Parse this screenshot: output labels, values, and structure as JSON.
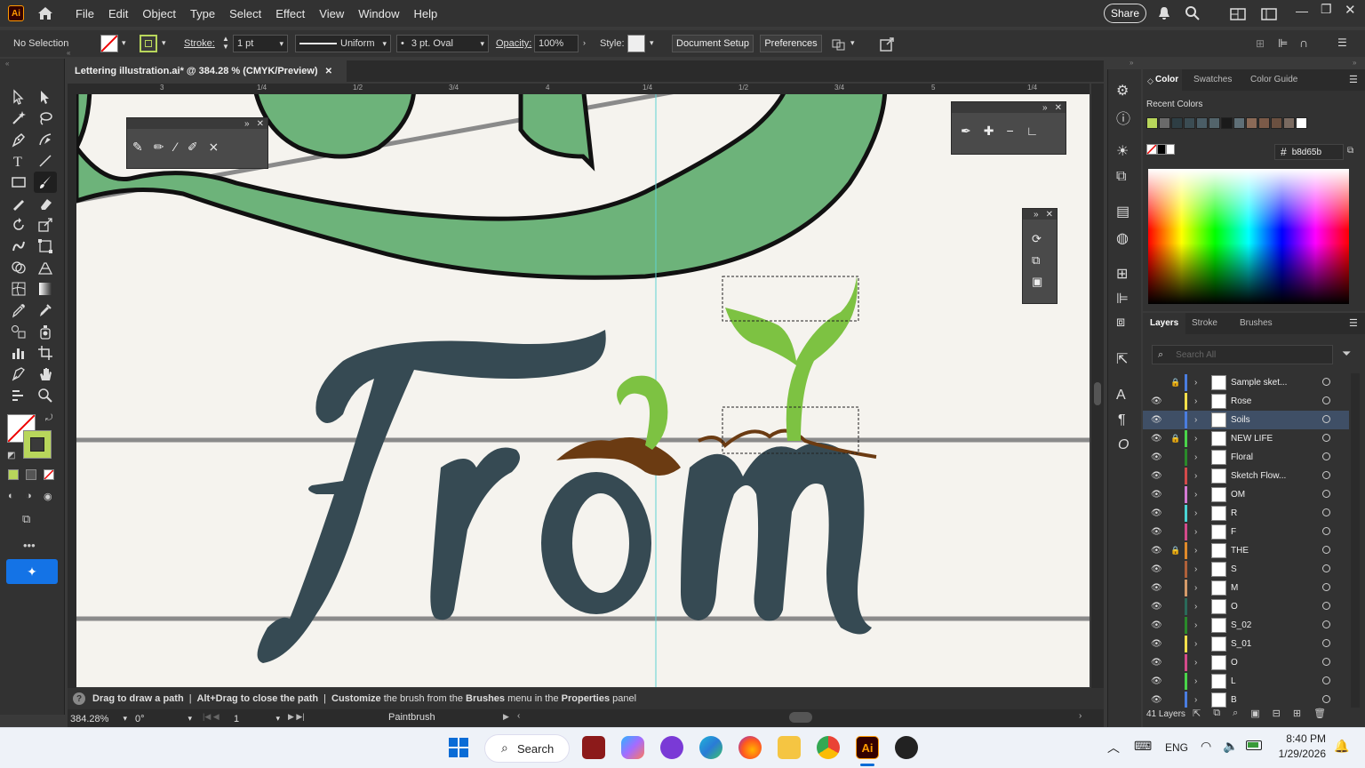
{
  "app": {
    "logo": "Ai"
  },
  "menu": [
    "File",
    "Edit",
    "Object",
    "Type",
    "Select",
    "Effect",
    "View",
    "Window",
    "Help"
  ],
  "topright": {
    "share": "Share"
  },
  "control": {
    "selection": "No Selection",
    "stroke_label": "Stroke:",
    "stroke_value": "1 pt",
    "profile": "Uniform",
    "brush": "3 pt. Oval",
    "opacity_label": "Opacity:",
    "opacity_value": "100%",
    "style_label": "Style:",
    "doc_setup": "Document Setup",
    "preferences": "Preferences"
  },
  "document": {
    "tab": "Lettering illustration.ai* @ 384.28 % (CMYK/Preview)"
  },
  "ruler": {
    "marks": [
      "3",
      "1/4",
      "1/2",
      "3/4",
      "4",
      "1/4",
      "1/2",
      "3/4",
      "5",
      "1/4"
    ]
  },
  "status": {
    "hint_1": "Drag to draw a path",
    "hint_sep": "|",
    "hint_2": "Alt+Drag to close the path",
    "hint_3a": "Customize",
    "hint_3b": " the brush from the ",
    "hint_3c": "Brushes",
    "hint_3d": " menu in the ",
    "hint_3e": "Properties",
    "hint_3f": " panel",
    "zoom": "384.28%",
    "angle": "0°",
    "artboard": "1",
    "tool": "Paintbrush"
  },
  "color_panel": {
    "tabs": [
      "Color",
      "Swatches",
      "Color Guide"
    ],
    "recent_label": "Recent Colors",
    "hex": "b8d65b",
    "recent_colors": [
      "#b8d65b",
      "#6a6a6a",
      "#2e3e44",
      "#3b4c53",
      "#4a5d66",
      "#53646b",
      "#1a1a1a",
      "#5f6f77",
      "#8b6a57",
      "#7b5a48",
      "#6b5040",
      "#7a6a60",
      "#ffffff"
    ]
  },
  "layers_panel": {
    "tabs": [
      "Layers",
      "Stroke",
      "Brushes"
    ],
    "search_placeholder": "Search All",
    "count": "41 Layers",
    "layers": [
      {
        "name": "Sample sket...",
        "color": "#4a7de0",
        "locked": true,
        "visible": false
      },
      {
        "name": "Rose",
        "color": "#f5e04a",
        "locked": false,
        "visible": true
      },
      {
        "name": "Soils",
        "color": "#4a7de0",
        "locked": false,
        "visible": true
      },
      {
        "name": "NEW LIFE",
        "color": "#4ad44a",
        "locked": true,
        "visible": true
      },
      {
        "name": "Floral",
        "color": "#2a8a2a",
        "locked": false,
        "visible": true
      },
      {
        "name": "Sketch Flow...",
        "color": "#d44a4a",
        "locked": false,
        "visible": true
      },
      {
        "name": "OM",
        "color": "#d47ad4",
        "locked": false,
        "visible": true
      },
      {
        "name": "R",
        "color": "#4ad4d4",
        "locked": false,
        "visible": true
      },
      {
        "name": "F",
        "color": "#d44a8a",
        "locked": false,
        "visible": true
      },
      {
        "name": "THE",
        "color": "#e08a2a",
        "locked": true,
        "visible": true
      },
      {
        "name": "S",
        "color": "#b0603a",
        "locked": false,
        "visible": true
      },
      {
        "name": "M",
        "color": "#d49a6a",
        "locked": false,
        "visible": true
      },
      {
        "name": "O",
        "color": "#2a6a5a",
        "locked": false,
        "visible": true
      },
      {
        "name": "S_02",
        "color": "#2a8a2a",
        "locked": false,
        "visible": true
      },
      {
        "name": "S_01",
        "color": "#f5e04a",
        "locked": false,
        "visible": true
      },
      {
        "name": "O",
        "color": "#d44a8a",
        "locked": false,
        "visible": true
      },
      {
        "name": "L",
        "color": "#4ad44a",
        "locked": false,
        "visible": true
      },
      {
        "name": "B",
        "color": "#4a7de0",
        "locked": false,
        "visible": true
      }
    ]
  },
  "taskbar": {
    "search": "Search",
    "lang": "ENG",
    "time": "8:40 PM",
    "date": "1/29/2026"
  },
  "colors": {
    "accent": "#b8d65b",
    "letter": "#364a53",
    "leaf": "#6db37a",
    "sprout": "#7dc242",
    "soil": "#6b3b12"
  }
}
